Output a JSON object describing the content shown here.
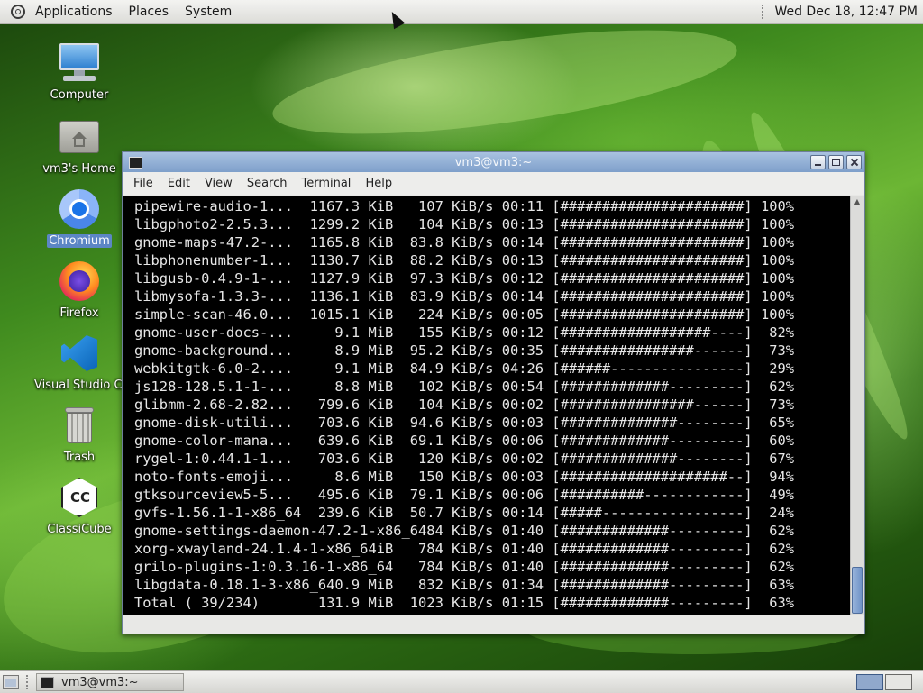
{
  "top_panel": {
    "menus": [
      "Applications",
      "Places",
      "System"
    ],
    "clock": "Wed Dec 18, 12:47 PM"
  },
  "desktop_icons": [
    {
      "label": "Computer",
      "icon": "computer-icon"
    },
    {
      "label": "vm3's Home",
      "icon": "home-folder-icon"
    },
    {
      "label": "Chromium",
      "icon": "chromium-icon"
    },
    {
      "label": "Firefox",
      "icon": "firefox-icon"
    },
    {
      "label": "Visual Studio Code",
      "icon": "vscode-icon"
    },
    {
      "label": "Trash",
      "icon": "trash-icon"
    },
    {
      "label": "ClassiCube",
      "icon": "classicube-icon"
    }
  ],
  "terminal": {
    "title": "vm3@vm3:~",
    "menus": [
      "File",
      "Edit",
      "View",
      "Search",
      "Terminal",
      "Help"
    ],
    "lines": [
      "pipewire-audio-1...  1167.3 KiB   107 KiB/s 00:11 [######################] 100%",
      "libgphoto2-2.5.3...  1299.2 KiB   104 KiB/s 00:13 [######################] 100%",
      "gnome-maps-47.2-...  1165.8 KiB  83.8 KiB/s 00:14 [######################] 100%",
      "libphonenumber-1...  1130.7 KiB  88.2 KiB/s 00:13 [######################] 100%",
      "libgusb-0.4.9-1-...  1127.9 KiB  97.3 KiB/s 00:12 [######################] 100%",
      "libmysofa-1.3.3-...  1136.1 KiB  83.9 KiB/s 00:14 [######################] 100%",
      "simple-scan-46.0...  1015.1 KiB   224 KiB/s 00:05 [######################] 100%",
      "gnome-user-docs-...     9.1 MiB   155 KiB/s 00:12 [##################----]  82%",
      "gnome-background...     8.9 MiB  95.2 KiB/s 00:35 [################------]  73%",
      "webkitgtk-6.0-2....     9.1 MiB  84.9 KiB/s 04:26 [######----------------]  29%",
      "js128-128.5.1-1-...     8.8 MiB   102 KiB/s 00:54 [#############---------]  62%",
      "glibmm-2.68-2.82...   799.6 KiB   104 KiB/s 00:02 [################------]  73%",
      "gnome-disk-utili...   703.6 KiB  94.6 KiB/s 00:03 [##############--------]  65%",
      "gnome-color-mana...   639.6 KiB  69.1 KiB/s 00:06 [#############---------]  60%",
      "rygel-1:0.44.1-1...   703.6 KiB   120 KiB/s 00:02 [##############--------]  67%",
      "noto-fonts-emoji...     8.6 MiB   150 KiB/s 00:03 [####################--]  94%",
      "gtksourceview5-5...   495.6 KiB  79.1 KiB/s 00:06 [##########------------]  49%",
      "gvfs-1.56.1-1-x86_64  239.6 KiB  50.7 KiB/s 00:14 [#####-----------------]  24%",
      "gnome-settings-daemon-47.2-1-x86_6484 KiB/s 01:40 [#############---------]  62%",
      "xorg-xwayland-24.1.4-1-x86_64iB   784 KiB/s 01:40 [#############---------]  62%",
      "grilo-plugins-1:0.3.16-1-x86_64   784 KiB/s 01:40 [#############---------]  62%",
      "libgdata-0.18.1-3-x86_640.9 MiB   832 KiB/s 01:34 [#############---------]  63%",
      "Total ( 39/234)       131.9 MiB  1023 KiB/s 01:15 [#############---------]  63%"
    ]
  },
  "taskbar": {
    "task_label": "vm3@vm3:~"
  },
  "colors": {
    "titlebar": "#8fadd4",
    "terminal_bg": "#000000",
    "terminal_fg": "#e6e6e6",
    "selection": "#5c86c5"
  }
}
